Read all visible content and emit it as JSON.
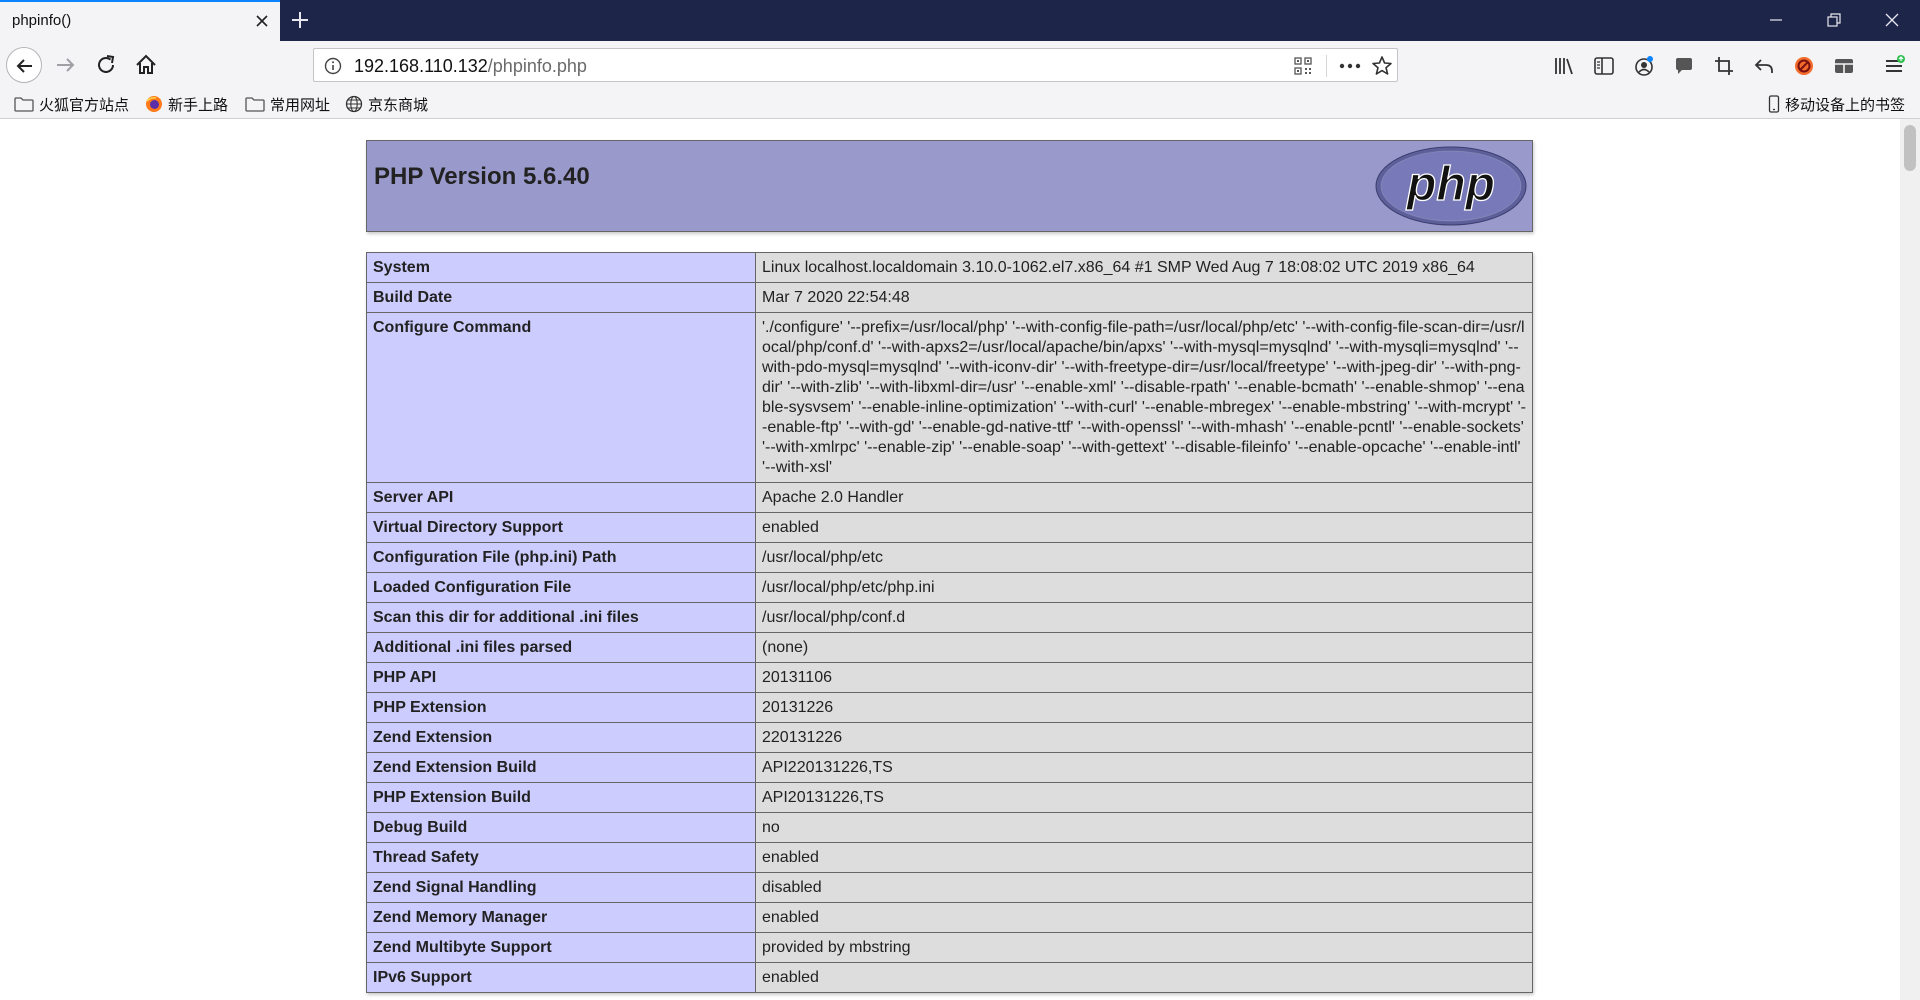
{
  "browser": {
    "tab_title": "phpinfo()",
    "url_host": "192.168.110.132",
    "url_path": "/phpinfo.php",
    "bookmarks": [
      "火狐官方站点",
      "新手上路",
      "常用网址",
      "京东商城"
    ],
    "mobile_bookmarks": "移动设备上的书签"
  },
  "php": {
    "version_title": "PHP Version 5.6.40",
    "logo_text": "php",
    "rows": [
      {
        "key": "System",
        "value": "Linux localhost.localdomain 3.10.0-1062.el7.x86_64 #1 SMP Wed Aug 7 18:08:02 UTC 2019 x86_64"
      },
      {
        "key": "Build Date",
        "value": "Mar 7 2020 22:54:48"
      },
      {
        "key": "Configure Command",
        "value": "'./configure' '--prefix=/usr/local/php' '--with-config-file-path=/usr/local/php/etc' '--with-config-file-scan-dir=/usr/local/php/conf.d' '--with-apxs2=/usr/local/apache/bin/apxs' '--with-mysql=mysqlnd' '--with-mysqli=mysqlnd' '--with-pdo-mysql=mysqlnd' '--with-iconv-dir' '--with-freetype-dir=/usr/local/freetype' '--with-jpeg-dir' '--with-png-dir' '--with-zlib' '--with-libxml-dir=/usr' '--enable-xml' '--disable-rpath' '--enable-bcmath' '--enable-shmop' '--enable-sysvsem' '--enable-inline-optimization' '--with-curl' '--enable-mbregex' '--enable-mbstring' '--with-mcrypt' '--enable-ftp' '--with-gd' '--enable-gd-native-ttf' '--with-openssl' '--with-mhash' '--enable-pcntl' '--enable-sockets' '--with-xmlrpc' '--enable-zip' '--enable-soap' '--with-gettext' '--disable-fileinfo' '--enable-opcache' '--enable-intl' '--with-xsl'"
      },
      {
        "key": "Server API",
        "value": "Apache 2.0 Handler"
      },
      {
        "key": "Virtual Directory Support",
        "value": "enabled"
      },
      {
        "key": "Configuration File (php.ini) Path",
        "value": "/usr/local/php/etc"
      },
      {
        "key": "Loaded Configuration File",
        "value": "/usr/local/php/etc/php.ini"
      },
      {
        "key": "Scan this dir for additional .ini files",
        "value": "/usr/local/php/conf.d"
      },
      {
        "key": "Additional .ini files parsed",
        "value": "(none)"
      },
      {
        "key": "PHP API",
        "value": "20131106"
      },
      {
        "key": "PHP Extension",
        "value": "20131226"
      },
      {
        "key": "Zend Extension",
        "value": "220131226"
      },
      {
        "key": "Zend Extension Build",
        "value": "API220131226,TS"
      },
      {
        "key": "PHP Extension Build",
        "value": "API20131226,TS"
      },
      {
        "key": "Debug Build",
        "value": "no"
      },
      {
        "key": "Thread Safety",
        "value": "enabled"
      },
      {
        "key": "Zend Signal Handling",
        "value": "disabled"
      },
      {
        "key": "Zend Memory Manager",
        "value": "enabled"
      },
      {
        "key": "Zend Multibyte Support",
        "value": "provided by mbstring"
      },
      {
        "key": "IPv6 Support",
        "value": "enabled"
      }
    ]
  },
  "colors": {
    "header_bg": "#9999cc",
    "key_bg": "#ccccff",
    "value_bg": "#dddddd",
    "tabstrip_bg": "#1d2549",
    "accent": "#0a84ff"
  }
}
